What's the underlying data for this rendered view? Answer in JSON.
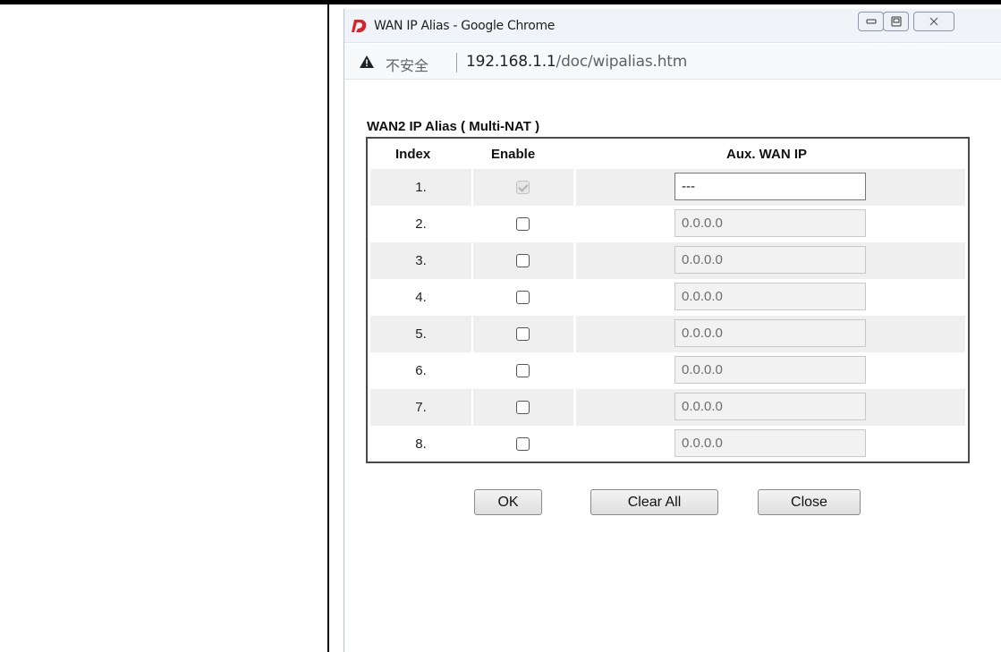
{
  "window": {
    "title": "WAN IP Alias - Google Chrome",
    "insecure_label": "不安全",
    "url_host": "192.168.1.1",
    "url_path": "/doc/wipalias.htm"
  },
  "section_title": "WAN2  IP Alias ( Multi-NAT )",
  "table": {
    "headers": {
      "index": "Index",
      "enable": "Enable",
      "ip": "Aux. WAN IP"
    },
    "rows": [
      {
        "index": "1.",
        "enabled": true,
        "disabled": true,
        "ip": "---"
      },
      {
        "index": "2.",
        "enabled": false,
        "disabled": false,
        "ip": "0.0.0.0"
      },
      {
        "index": "3.",
        "enabled": false,
        "disabled": false,
        "ip": "0.0.0.0"
      },
      {
        "index": "4.",
        "enabled": false,
        "disabled": false,
        "ip": "0.0.0.0"
      },
      {
        "index": "5.",
        "enabled": false,
        "disabled": false,
        "ip": "0.0.0.0"
      },
      {
        "index": "6.",
        "enabled": false,
        "disabled": false,
        "ip": "0.0.0.0"
      },
      {
        "index": "7.",
        "enabled": false,
        "disabled": false,
        "ip": "0.0.0.0"
      },
      {
        "index": "8.",
        "enabled": false,
        "disabled": false,
        "ip": "0.0.0.0"
      }
    ]
  },
  "buttons": {
    "ok": "OK",
    "clear_all": "Clear All",
    "close": "Close"
  },
  "colors": {
    "brand_icon": "#d8232a",
    "table_border": "#4a4a4a",
    "row_shade": "#efefef"
  },
  "icons": {
    "app": "draytek-logo-icon",
    "warning": "warning-icon"
  }
}
